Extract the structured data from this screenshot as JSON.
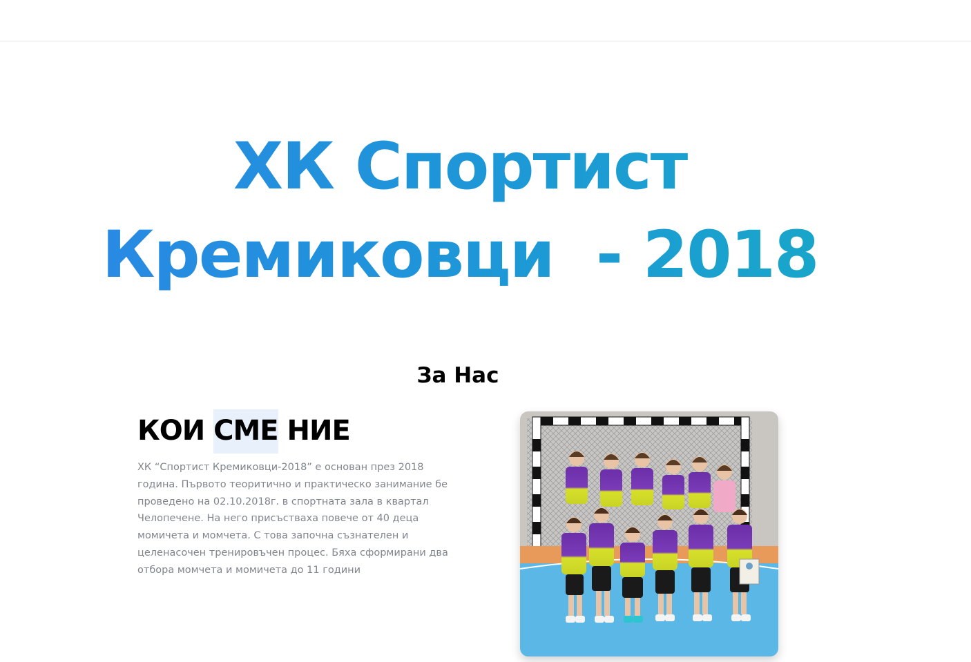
{
  "hero": {
    "title_line1": "ХК Спортист",
    "title_line2": "Кремиковци  - 2018",
    "gradient_colors": [
      "#2b86e6",
      "#17aac6"
    ]
  },
  "about": {
    "section_title": "За Нас",
    "heading_part1": "КОИ",
    "heading_part2": "СМЕ",
    "heading_part3": "НИЕ",
    "paragraph": "ХК “Спортист Кремиковци-2018” е основан през 2018 година. Първото теоритично и практическо занимание бе проведено на 02.10.2018г. в спортната зала в квартал Челопечене. На него присъстваха повече от 40 деца момичета и момчета. С това започна съзнателен и целенасочен тренировъчен процес. Бяха сформирани два отбора момчета и момичета до 11 години",
    "text_color": "#80858d"
  }
}
